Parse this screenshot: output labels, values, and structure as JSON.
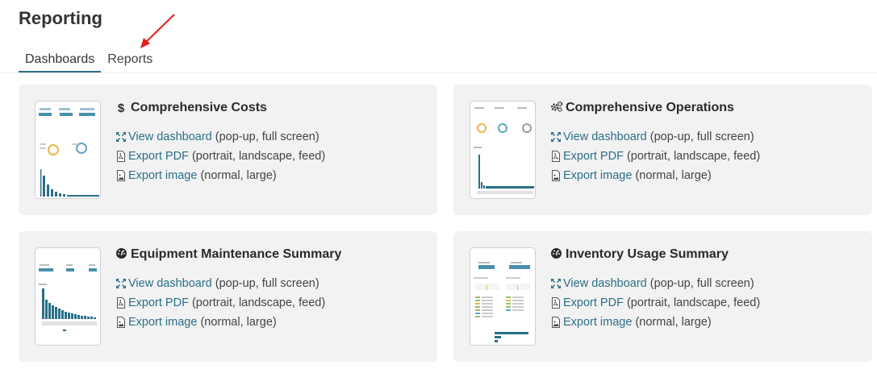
{
  "page": {
    "title": "Reporting"
  },
  "tabs": [
    {
      "label": "Dashboards",
      "active": true
    },
    {
      "label": "Reports",
      "active": false
    }
  ],
  "annotation": {
    "arrow_color": "#e0201c"
  },
  "colors": {
    "link": "#2a6f86",
    "card_bg": "#f2f2f2",
    "chart_bar": "#2a6f86"
  },
  "cards": [
    {
      "title": "Comprehensive Costs",
      "icon": "dollar-icon",
      "actions": [
        {
          "link": "View dashboard",
          "options": "(pop-up, full screen)",
          "icon": "expand-icon"
        },
        {
          "link": "Export PDF",
          "options": "(portrait, landscape, feed)",
          "icon": "pdf-icon"
        },
        {
          "link": "Export image",
          "options": "(normal, large)",
          "icon": "image-icon"
        }
      ]
    },
    {
      "title": "Comprehensive Operations",
      "icon": "gears-icon",
      "actions": [
        {
          "link": "View dashboard",
          "options": "(pop-up, full screen)",
          "icon": "expand-icon"
        },
        {
          "link": "Export PDF",
          "options": "(portrait, landscape, feed)",
          "icon": "pdf-icon"
        },
        {
          "link": "Export image",
          "options": "(normal, large)",
          "icon": "image-icon"
        }
      ]
    },
    {
      "title": "Equipment Maintenance Summary",
      "icon": "dashboard-gauge-icon",
      "actions": [
        {
          "link": "View dashboard",
          "options": "(pop-up, full screen)",
          "icon": "expand-icon"
        },
        {
          "link": "Export PDF",
          "options": "(portrait, landscape, feed)",
          "icon": "pdf-icon"
        },
        {
          "link": "Export image",
          "options": "(normal, large)",
          "icon": "image-icon"
        }
      ]
    },
    {
      "title": "Inventory Usage Summary",
      "icon": "dashboard-gauge-icon",
      "actions": [
        {
          "link": "View dashboard",
          "options": "(pop-up, full screen)",
          "icon": "expand-icon"
        },
        {
          "link": "Export PDF",
          "options": "(portrait, landscape, feed)",
          "icon": "pdf-icon"
        },
        {
          "link": "Export image",
          "options": "(normal, large)",
          "icon": "image-icon"
        }
      ]
    }
  ]
}
